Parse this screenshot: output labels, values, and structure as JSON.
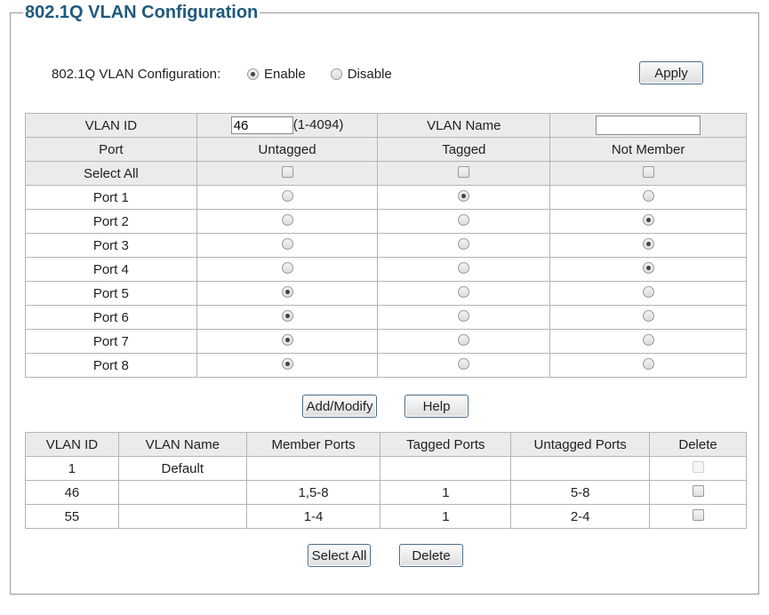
{
  "title": "802.1Q VLAN Configuration",
  "config": {
    "label": "802.1Q VLAN Configuration:",
    "enable_label": "Enable",
    "disable_label": "Disable",
    "selected": "enable",
    "apply_label": "Apply"
  },
  "vlan_form": {
    "vlan_id_label": "VLAN ID",
    "vlan_id_value": "46",
    "vlan_id_range": "(1-4094)",
    "vlan_name_label": "VLAN Name",
    "vlan_name_value": "",
    "columns": [
      "Port",
      "Untagged",
      "Tagged",
      "Not Member"
    ],
    "select_all_label": "Select All",
    "ports": [
      {
        "name": "Port 1",
        "mode": "tagged"
      },
      {
        "name": "Port 2",
        "mode": "not_member"
      },
      {
        "name": "Port 3",
        "mode": "not_member"
      },
      {
        "name": "Port 4",
        "mode": "not_member"
      },
      {
        "name": "Port 5",
        "mode": "untagged"
      },
      {
        "name": "Port 6",
        "mode": "untagged"
      },
      {
        "name": "Port 7",
        "mode": "untagged"
      },
      {
        "name": "Port 8",
        "mode": "untagged"
      }
    ]
  },
  "actions": {
    "add_modify_label": "Add/Modify",
    "help_label": "Help",
    "select_all_label": "Select All",
    "delete_label": "Delete"
  },
  "vlan_table": {
    "columns": [
      "VLAN ID",
      "VLAN Name",
      "Member Ports",
      "Tagged Ports",
      "Untagged Ports",
      "Delete"
    ],
    "rows": [
      {
        "id": "1",
        "name": "Default",
        "members": "",
        "tagged": "",
        "untagged": "",
        "deletable": false
      },
      {
        "id": "46",
        "name": "",
        "members": "1,5-8",
        "tagged": "1",
        "untagged": "5-8",
        "deletable": true
      },
      {
        "id": "55",
        "name": "",
        "members": "1-4",
        "tagged": "1",
        "untagged": "2-4",
        "deletable": true
      }
    ]
  }
}
